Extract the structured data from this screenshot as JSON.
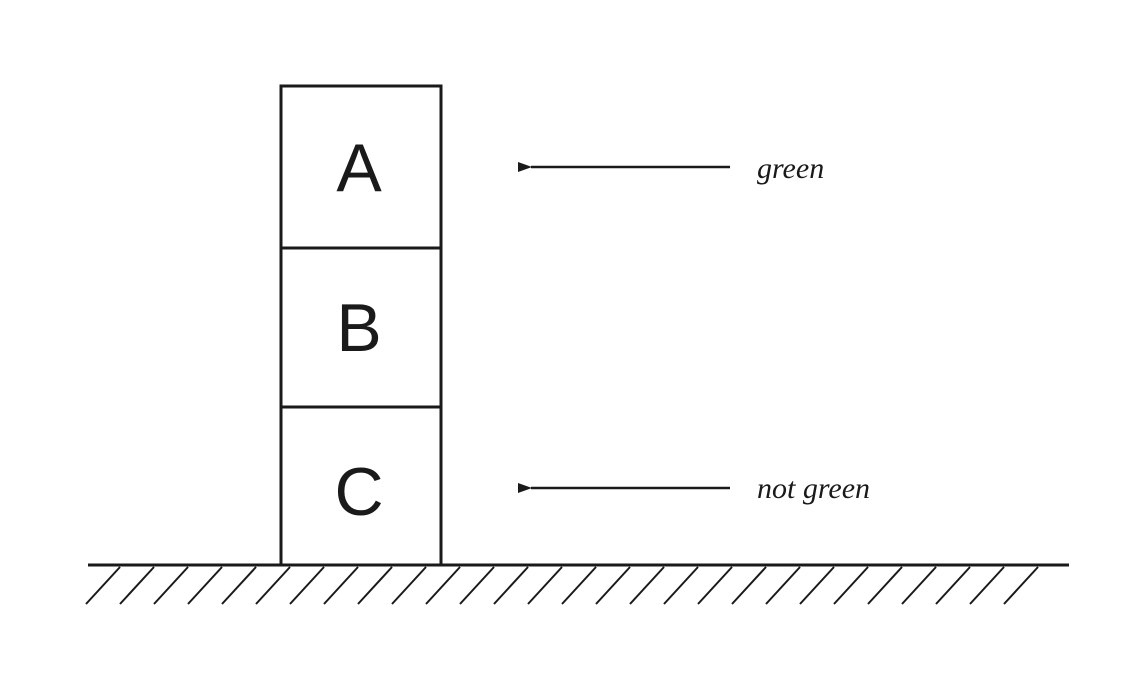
{
  "blocks": [
    {
      "label": "A"
    },
    {
      "label": "B"
    },
    {
      "label": "C"
    }
  ],
  "annotations": [
    {
      "label": "green",
      "points_to": "A"
    },
    {
      "label": "not green",
      "points_to": "C"
    }
  ],
  "colors": {
    "stroke": "#1a1a1a",
    "background": "#ffffff"
  }
}
